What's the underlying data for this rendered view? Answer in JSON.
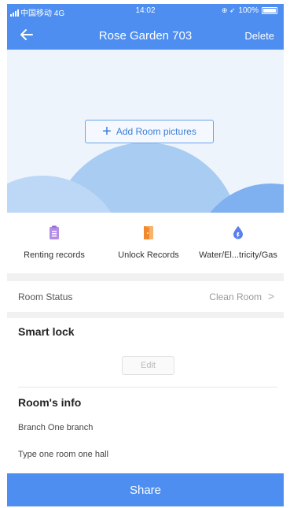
{
  "status_bar": {
    "carrier": "中国移动  4G",
    "time": "14:02",
    "battery": "100%"
  },
  "nav": {
    "title": "Rose Garden 703",
    "delete_label": "Delete"
  },
  "hero": {
    "add_pictures_label": "Add Room pictures"
  },
  "features": [
    {
      "label": "Renting records",
      "icon": "clipboard-icon",
      "color": "#b48ee6"
    },
    {
      "label": "Unlock Records",
      "icon": "door-icon",
      "color": "#f08a2e"
    },
    {
      "label": "Water/El...tricity/Gas",
      "icon": "drop-icon",
      "color": "#5a7ff0"
    }
  ],
  "room_status": {
    "label": "Room Status",
    "value": "Clean Room"
  },
  "smart_lock": {
    "title": "Smart lock",
    "edit_label": "Edit"
  },
  "room_info": {
    "title": "Room's info",
    "branch_label": "Branch",
    "branch_value": "One branch",
    "type_label": "Type",
    "type_value": "one room one hall"
  },
  "share_label": "Share",
  "colors": {
    "primary": "#4d8ef0",
    "hero_bg": "#eef4fc"
  }
}
